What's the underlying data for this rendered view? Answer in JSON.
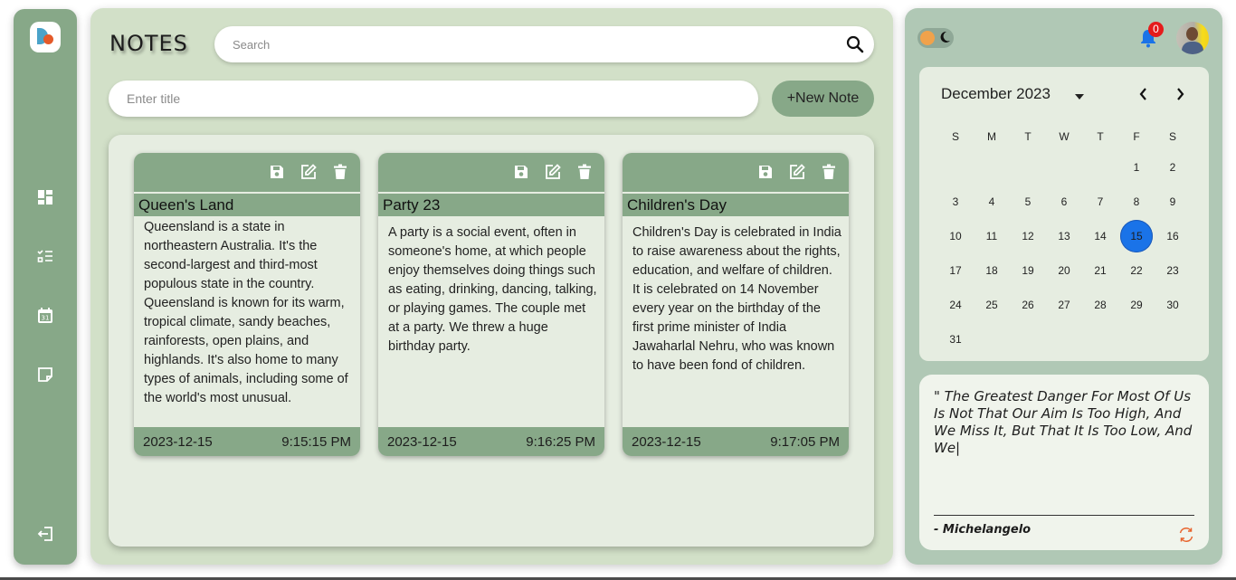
{
  "sidebar": {
    "icons": [
      "app-logo",
      "dashboard-icon",
      "checklist-icon",
      "calendar-icon",
      "sticky-note-icon",
      "logout-icon"
    ],
    "calendar_icon_text": "31"
  },
  "header": {
    "title": "NOTES",
    "search_placeholder": "Search",
    "title_placeholder": "Enter title",
    "new_note_label": "+New Note"
  },
  "notes": [
    {
      "title": "Queen's Land",
      "body": "Queensland is a state in northeastern Australia. It's the second-largest and third-most populous state in the country.\n Queensland is known for its warm, tropical climate, sandy beaches, rainforests, open plains, and highlands. It's also home to many types of animals, including some of the world's most unusual.",
      "date": "2023-12-15",
      "time": "9:15:15 PM"
    },
    {
      "title": "Party 23",
      "body": "A party is a social event, often in someone's home, at which people enjoy themselves doing things such as eating, drinking, dancing, talking, or playing games. The couple met at a party. We threw a huge birthday party.",
      "date": "2023-12-15",
      "time": "9:16:25 PM"
    },
    {
      "title": "Children's Day",
      "body": "Children's Day is celebrated in India to raise awareness about the rights, education, and welfare of children. It is celebrated on 14 November every year on the birthday of the first prime minister of India Jawaharlal Nehru, who was known to have been fond of children.",
      "date": "2023-12-15",
      "time": "9:17:05 PM"
    }
  ],
  "notification_count": "0",
  "calendar": {
    "month_label": "December 2023",
    "weekdays": [
      "S",
      "M",
      "T",
      "W",
      "T",
      "F",
      "S"
    ],
    "leading_blanks": 5,
    "days_in_month": 31,
    "today": 15
  },
  "quote": {
    "text": "\" The Greatest Danger For Most Of Us Is Not That Our Aim Is Too High, And We Miss It, But That It Is Too Low, And We|",
    "author": "- Michelangelo"
  },
  "colors": {
    "sidebar": "#87a888",
    "main_panel": "#d2e0c8",
    "right_panel": "#b0c8b5",
    "today_highlight": "#1a73e8",
    "badge": "#e51c1c",
    "refresh_icon": "#e8632c"
  }
}
